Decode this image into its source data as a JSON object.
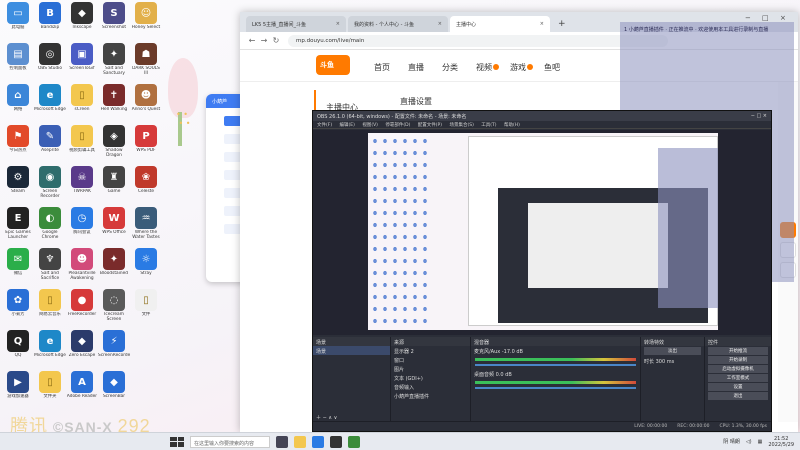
{
  "desktop": {
    "icons": [
      {
        "label": "此电脑",
        "color": "#3d8ee0",
        "glyph": "▭"
      },
      {
        "label": "Bandizip",
        "color": "#2a6fd6",
        "glyph": "B"
      },
      {
        "label": "Inkscape",
        "color": "#333333",
        "glyph": "◆"
      },
      {
        "label": "Screenshot",
        "color": "#4d4d8a",
        "glyph": "S"
      },
      {
        "label": "Honey Select",
        "color": "#e2b04a",
        "glyph": "☺"
      },
      {
        "label": "控制面板",
        "color": "#5c8fd0",
        "glyph": "▤"
      },
      {
        "label": "OBS Studio",
        "color": "#333333",
        "glyph": "◎"
      },
      {
        "label": "ScreenToGif",
        "color": "#4a5cc5",
        "glyph": "▣"
      },
      {
        "label": "Salt and Sanctuary",
        "color": "#444444",
        "glyph": "✦"
      },
      {
        "label": "DARK SOULS III",
        "color": "#6b3b2a",
        "glyph": "☗"
      },
      {
        "label": "网络",
        "color": "#3c86d8",
        "glyph": "⌂"
      },
      {
        "label": "Microsoft Edge",
        "color": "#1e88c8",
        "glyph": "e"
      },
      {
        "label": "sCreen",
        "color": "#f3c74e",
        "glyph": "▯"
      },
      {
        "label": "Hell Walking",
        "color": "#7a2b2b",
        "glyph": "✝"
      },
      {
        "label": "Anno's Quest",
        "color": "#b07040",
        "glyph": "☻"
      },
      {
        "label": "今日热点",
        "color": "#e24a2a",
        "glyph": "⚑"
      },
      {
        "label": "Aseprite",
        "color": "#3b5fb5",
        "glyph": "✎"
      },
      {
        "label": "视频剪辑工具",
        "color": "#f3c74e",
        "glyph": "▯"
      },
      {
        "label": "Shadow Dragon",
        "color": "#333333",
        "glyph": "◈"
      },
      {
        "label": "WPS PDF",
        "color": "#d63a3a",
        "glyph": "P"
      },
      {
        "label": "Steam",
        "color": "#1b2838",
        "glyph": "⚙"
      },
      {
        "label": "Screen Recorder",
        "color": "#2f6d6d",
        "glyph": "◉"
      },
      {
        "label": "TWRPAK",
        "color": "#5a3a8a",
        "glyph": "☠"
      },
      {
        "label": "Game",
        "color": "#444444",
        "glyph": "♜"
      },
      {
        "label": "Celeste",
        "color": "#c0392b",
        "glyph": "❀"
      },
      {
        "label": "Epic Games Launcher",
        "color": "#222222",
        "glyph": "E"
      },
      {
        "label": "Google Chrome",
        "color": "#3b8c3b",
        "glyph": "◐"
      },
      {
        "label": "腾讯会议",
        "color": "#2a7be4",
        "glyph": "◷"
      },
      {
        "label": "WPS Office",
        "color": "#d63a3a",
        "glyph": "W"
      },
      {
        "label": "Where the Water Tastes",
        "color": "#3a5c7a",
        "glyph": "♒"
      },
      {
        "label": "微信",
        "color": "#2bae4a",
        "glyph": "✉"
      },
      {
        "label": "Salt and Sacrifice",
        "color": "#444444",
        "glyph": "♆"
      },
      {
        "label": "Pleasantville Awakening",
        "color": "#d24a7a",
        "glyph": "☻"
      },
      {
        "label": "Bloodstained",
        "color": "#7a2b2b",
        "glyph": "✦"
      },
      {
        "label": "Stray",
        "color": "#2a7be4",
        "glyph": "☼"
      },
      {
        "label": "小菊芳",
        "color": "#2a6fd6",
        "glyph": "✿"
      },
      {
        "label": "网易云音乐",
        "color": "#f3c74e",
        "glyph": "▯"
      },
      {
        "label": "FreeRecorder",
        "color": "#d63a3a",
        "glyph": "●"
      },
      {
        "label": "Icecream Screen",
        "color": "#5a5a5a",
        "glyph": "◌"
      },
      {
        "label": "文件",
        "color": "#f0f0f0",
        "glyph": "▯"
      },
      {
        "label": "QQ",
        "color": "#222222",
        "glyph": "Q"
      },
      {
        "label": "Microsoft Edge",
        "color": "#1e88c8",
        "glyph": "e"
      },
      {
        "label": "Zero Escape",
        "color": "#2b3b6b",
        "glyph": "◆"
      },
      {
        "label": "ScreenRecorder",
        "color": "#2a6fd6",
        "glyph": "⚡"
      },
      {
        "label": "",
        "color": "transparent",
        "glyph": ""
      },
      {
        "label": "游戏加速器",
        "color": "#2a4a8a",
        "glyph": "▶"
      },
      {
        "label": "文件夹",
        "color": "#f3c74e",
        "glyph": "▯"
      },
      {
        "label": "Adobe Reader",
        "color": "#2a6fd6",
        "glyph": "A"
      },
      {
        "label": "ScreenBar",
        "color": "#2a6fd6",
        "glyph": "◆"
      },
      {
        "label": "",
        "color": "transparent",
        "glyph": ""
      }
    ],
    "watermark_prefix": "腾讯",
    "watermark_text": "©SAN-X",
    "watermark_num": "292"
  },
  "mini_app": {
    "title": "小葫芦"
  },
  "browser": {
    "tabs": [
      {
        "label": "LK5 5主播_直播间_斗鱼",
        "close": "×"
      },
      {
        "label": "我的资料 - 个人中心 - 斗鱼",
        "close": "×"
      },
      {
        "label": "主播中心",
        "close": "×"
      }
    ],
    "new_tab": "+",
    "window_controls": [
      "−",
      "□",
      "×"
    ],
    "url": "mp.douyu.com/live/main",
    "nav": [
      "←",
      "→",
      "↻"
    ],
    "site": {
      "logo": "斗鱼",
      "menu": [
        "首页",
        "直播",
        "分类",
        "视频",
        "游戏",
        "鱼吧"
      ],
      "sidebar_title": "主播中心",
      "main_title": "直播设置"
    },
    "overlay_text": "1 小葫芦直播插件 · 正在推流中 · 欢迎使用本工具进行录制与直播"
  },
  "obs": {
    "title": "OBS 26.1.0 (64-bit, windows) - 配置文件: 未命名 - 场景: 未命名",
    "menu": [
      "文件(F)",
      "编辑(E)",
      "视图(V)",
      "停靠部件(D)",
      "配置文件(P)",
      "场景集合(S)",
      "工具(T)",
      "帮助(H)"
    ],
    "docks": {
      "scenes": {
        "title": "场景",
        "items": [
          "场景"
        ]
      },
      "sources": {
        "title": "来源",
        "items": [
          "显示器 2",
          "窗口",
          "图片",
          "文本 (GDI+)",
          "音频输入",
          "小葫芦直播插件"
        ]
      },
      "mixer": {
        "title": "混音器",
        "tracks": [
          "麦克风/Aux",
          "桌面音频"
        ],
        "levels": [
          "-17.0 dB",
          "0.0 dB"
        ]
      },
      "transitions": {
        "title": "转场特效",
        "type": "淡出",
        "duration_label": "时长",
        "duration": "300 ms"
      },
      "controls": {
        "title": "控件",
        "buttons": [
          "开始推流",
          "开始录制",
          "启动虚拟摄像机",
          "工作室模式",
          "设置",
          "退出"
        ]
      }
    },
    "status": [
      "LIVE: 00:00:00",
      "REC: 00:00:00",
      "CPU: 1.3%, 30.00 fps"
    ]
  },
  "taskbar": {
    "search_placeholder": "在这里输入你要搜索的内容",
    "tray_weather": "阴 晴朗",
    "time": "21:52",
    "date": "2022/5/29"
  }
}
